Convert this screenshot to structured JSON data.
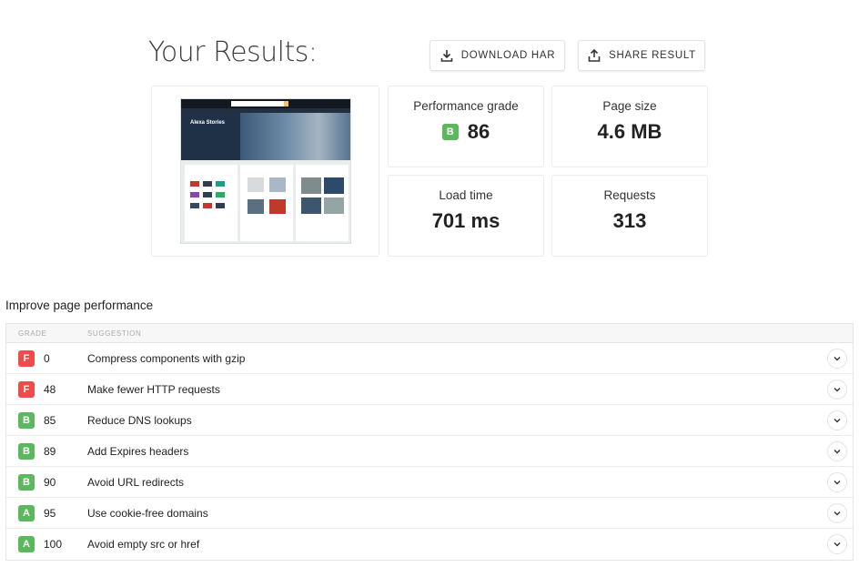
{
  "header": {
    "title": "Your Results:",
    "download_label": "DOWNLOAD HAR",
    "share_label": "SHARE RESULT"
  },
  "screenshot_preview": {
    "hero_text": "Alexa Stories"
  },
  "stats": {
    "performance": {
      "label": "Performance grade",
      "grade": "B",
      "value": "86"
    },
    "page_size": {
      "label": "Page size",
      "value": "4.6 MB"
    },
    "load_time": {
      "label": "Load time",
      "value": "701 ms"
    },
    "requests": {
      "label": "Requests",
      "value": "313"
    }
  },
  "improve": {
    "title": "Improve page performance",
    "columns": {
      "grade": "GRADE",
      "suggestion": "SUGGESTION"
    },
    "rows": [
      {
        "grade": "F",
        "score": "0",
        "suggestion": "Compress components with gzip"
      },
      {
        "grade": "F",
        "score": "48",
        "suggestion": "Make fewer HTTP requests"
      },
      {
        "grade": "B",
        "score": "85",
        "suggestion": "Reduce DNS lookups"
      },
      {
        "grade": "B",
        "score": "89",
        "suggestion": "Add Expires headers"
      },
      {
        "grade": "B",
        "score": "90",
        "suggestion": "Avoid URL redirects"
      },
      {
        "grade": "A",
        "score": "95",
        "suggestion": "Use cookie-free domains"
      },
      {
        "grade": "A",
        "score": "100",
        "suggestion": "Avoid empty src or href"
      }
    ]
  },
  "colors": {
    "grade_F": "#ee4b4b",
    "grade_B": "#5cb85c",
    "grade_A": "#5cb85c"
  },
  "icons": {
    "download": "download-icon",
    "share": "share-icon",
    "expand": "chevron-down-icon"
  }
}
